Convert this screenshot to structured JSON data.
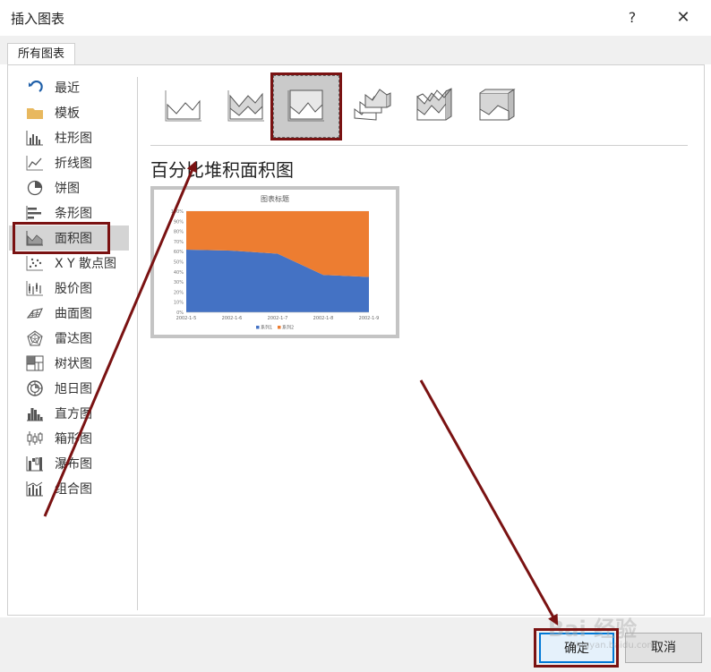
{
  "window": {
    "title": "插入图表",
    "help": "?",
    "close": "✕"
  },
  "tabs": [
    {
      "label": "所有图表"
    }
  ],
  "sidebar": {
    "items": [
      {
        "label": "最近",
        "icon": "recent-icon"
      },
      {
        "label": "模板",
        "icon": "folder-icon"
      },
      {
        "label": "柱形图",
        "icon": "column-chart-icon"
      },
      {
        "label": "折线图",
        "icon": "line-chart-icon"
      },
      {
        "label": "饼图",
        "icon": "pie-chart-icon"
      },
      {
        "label": "条形图",
        "icon": "bar-chart-icon"
      },
      {
        "label": "面积图",
        "icon": "area-chart-icon",
        "selected": true
      },
      {
        "label": "X Y 散点图",
        "icon": "scatter-chart-icon"
      },
      {
        "label": "股价图",
        "icon": "stock-chart-icon"
      },
      {
        "label": "曲面图",
        "icon": "surface-chart-icon"
      },
      {
        "label": "雷达图",
        "icon": "radar-chart-icon"
      },
      {
        "label": "树状图",
        "icon": "treemap-chart-icon"
      },
      {
        "label": "旭日图",
        "icon": "sunburst-chart-icon"
      },
      {
        "label": "直方图",
        "icon": "histogram-chart-icon"
      },
      {
        "label": "箱形图",
        "icon": "box-whisker-chart-icon"
      },
      {
        "label": "瀑布图",
        "icon": "waterfall-chart-icon"
      },
      {
        "label": "组合图",
        "icon": "combo-chart-icon"
      }
    ]
  },
  "subtypes": [
    {
      "icon": "area-icon"
    },
    {
      "icon": "stacked-area-icon"
    },
    {
      "icon": "percent-stacked-area-icon",
      "selected": true
    },
    {
      "icon": "3d-area-icon"
    },
    {
      "icon": "3d-stacked-area-icon"
    },
    {
      "icon": "3d-percent-stacked-area-icon"
    }
  ],
  "selected_subtype_title": "百分比堆积面积图",
  "chart_data": {
    "type": "area",
    "stacked": "percent",
    "title": "图表标题",
    "x": [
      "2002-1-5",
      "2002-1-6",
      "2002-1-7",
      "2002-1-8",
      "2002-1-9"
    ],
    "series": [
      {
        "name": "系列1",
        "values": [
          62,
          61,
          58,
          37,
          35
        ]
      },
      {
        "name": "系列2",
        "values": [
          38,
          39,
          42,
          63,
          65
        ]
      }
    ],
    "ylim": [
      0,
      100
    ],
    "yticks": [
      "100%",
      "90%",
      "80%",
      "70%",
      "60%",
      "50%",
      "40%",
      "30%",
      "20%",
      "10%",
      "0%"
    ],
    "legend": "bottom",
    "colors": [
      "#4472c4",
      "#ed7d31"
    ]
  },
  "footer": {
    "ok": "确定",
    "cancel": "取消"
  },
  "watermark": {
    "text": "Bai 经验",
    "sub": "jingyan.baidu.com"
  },
  "annotation_color": "#7a1212"
}
